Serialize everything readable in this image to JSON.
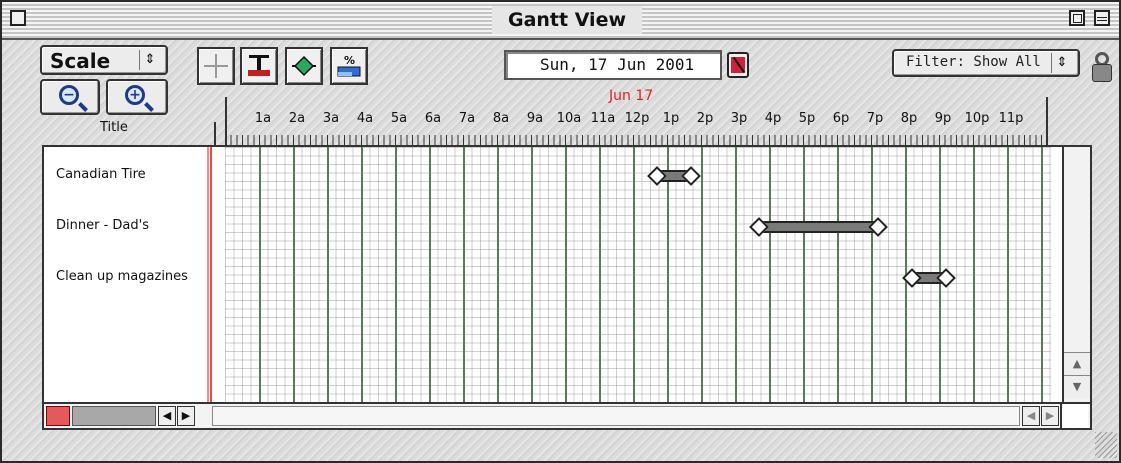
{
  "window": {
    "title": "Gantt View"
  },
  "toolbar": {
    "scale_label": "Scale",
    "scale_arrow": "⇕",
    "zoom_out_symbol": "−",
    "zoom_in_symbol": "+",
    "tools": [
      "crosshair-tool",
      "link-tasks-tool",
      "milestone-tool",
      "percent-complete-tool"
    ],
    "date_value": "Sun, 17 Jun 2001",
    "day_label": "Jun 17",
    "filter_label": "Filter: Show All",
    "filter_arrow": "⇕"
  },
  "columns": {
    "title_header": "Title"
  },
  "ruler": {
    "hours": [
      "1a",
      "2a",
      "3a",
      "4a",
      "5a",
      "6a",
      "7a",
      "8a",
      "9a",
      "10a",
      "11a",
      "12p",
      "1p",
      "2p",
      "3p",
      "4p",
      "5p",
      "6p",
      "7p",
      "8p",
      "9p",
      "10p",
      "11p"
    ]
  },
  "tasks": [
    {
      "title": "Canadian Tire",
      "start_hour": 12.5,
      "end_hour": 13.5
    },
    {
      "title": "Dinner - Dad's",
      "start_hour": 15.5,
      "end_hour": 19.0
    },
    {
      "title": "Clean up magazines",
      "start_hour": 20.0,
      "end_hour": 21.0
    }
  ],
  "scroll": {
    "up_arrow": "▲",
    "down_arrow": "▼",
    "left_arrow": "◀",
    "right_arrow": "▶"
  },
  "colors": {
    "today_marker": "#e84a4a",
    "bar_fill": "#7a7a7a",
    "hour_line": "#5a7a5a",
    "day_label": "#e02020"
  }
}
